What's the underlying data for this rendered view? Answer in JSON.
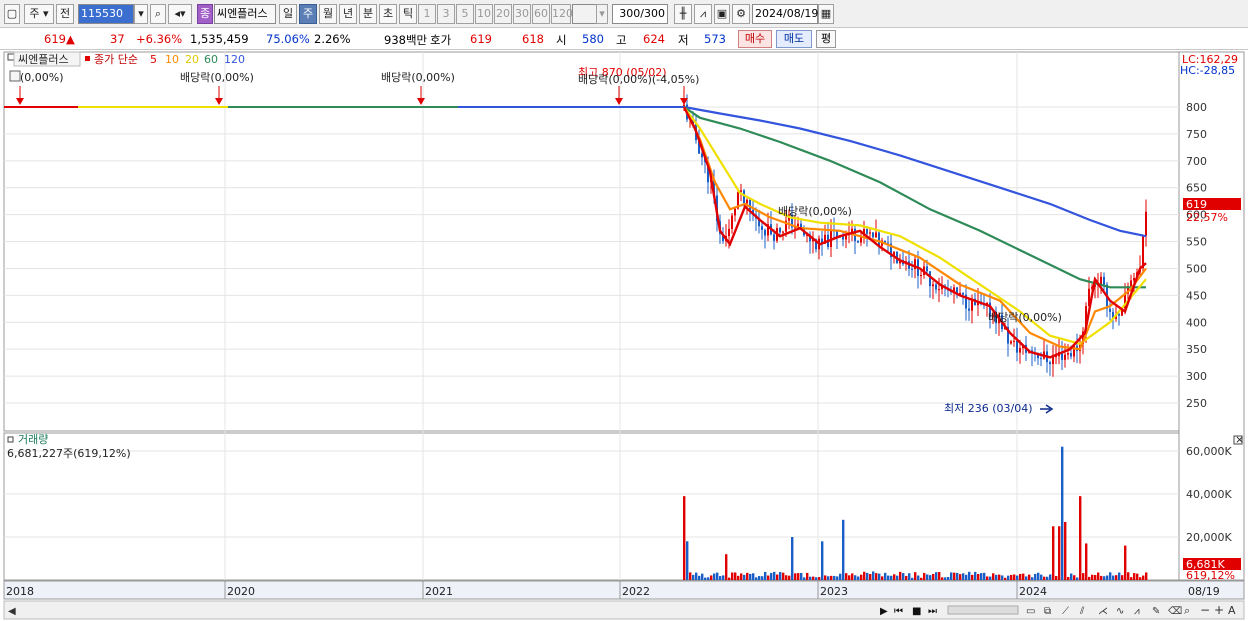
{
  "toolbar": {
    "market": "주",
    "prev": "전",
    "code": "115530",
    "stock_tag": "종",
    "stock_name": "씨엔플러스",
    "periods": [
      "일",
      "주",
      "월",
      "년",
      "분",
      "초",
      "틱"
    ],
    "active_period": "주",
    "intervals": [
      "1",
      "3",
      "5",
      "10",
      "20",
      "30",
      "60",
      "120"
    ],
    "count": "300/300",
    "date": "2024/08/19"
  },
  "quote": {
    "price": "619",
    "arrow": "▲",
    "change": "37",
    "change_pct": "+6.36%",
    "volume": "1,535,459",
    "vol_ratio": "75.06%",
    "turnover": "2.26%",
    "amount": "938백만",
    "hoga_label": "호가",
    "ask": "619",
    "bid": "618",
    "open_label": "시",
    "open": "580",
    "high_label": "고",
    "high": "624",
    "low_label": "저",
    "low": "573",
    "buy_label": "매수",
    "sell_label": "매도",
    "avg_label": "평"
  },
  "price_panel": {
    "stock_label": "씨엔플러스",
    "ma_label": "종가 단순",
    "ma_periods": [
      "5",
      "10",
      "20",
      "60",
      "120"
    ],
    "lc_label": "LC:162,29",
    "hc_label": "HC:-28,85",
    "current_price": "619",
    "current_pct": "22,57%",
    "y_ticks": [
      "800",
      "750",
      "700",
      "650",
      "600",
      "550",
      "500",
      "450",
      "400",
      "350",
      "300",
      "250"
    ]
  },
  "annotations": [
    {
      "text": "(0,00%)"
    },
    {
      "text": "배당락(0,00%)"
    },
    {
      "text": "배당락(0,00%)"
    },
    {
      "text": "최고 870 (05/02)"
    },
    {
      "text": "배당락(0,00%)(-4,05%)"
    },
    {
      "text": "배당락(0,00%)"
    },
    {
      "text": "배당락(0,00%)"
    },
    {
      "text": "최저 236 (03/04)"
    }
  ],
  "volume_panel": {
    "title": "거래량",
    "info": "6,681,227주(619,12%)",
    "y_ticks": [
      "60,000K",
      "40,000K",
      "20,000K"
    ],
    "current_label": "6,681K",
    "current_pct": "619,12%"
  },
  "x_axis": {
    "labels": [
      "2018",
      "2020",
      "2021",
      "2022",
      "2023",
      "2024"
    ],
    "end_label": "08/19"
  },
  "colors": {
    "ma5": "#e00000",
    "ma10": "#ff8800",
    "ma20": "#f0e000",
    "ma60": "#2e8b57",
    "ma120": "#3355dd",
    "up": "#e00000",
    "down": "#1a5fc8"
  }
}
